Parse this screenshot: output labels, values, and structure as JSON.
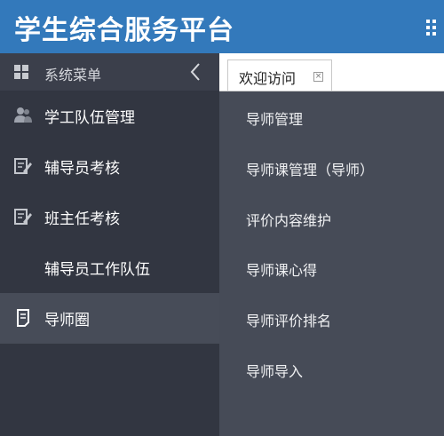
{
  "header": {
    "title": "学生综合服务平台"
  },
  "sidebar": {
    "menu_title": "系统菜单",
    "items": [
      {
        "label": "学工队伍管理",
        "icon": "users-icon"
      },
      {
        "label": "辅导员考核",
        "icon": "edit-icon"
      },
      {
        "label": "班主任考核",
        "icon": "edit-icon"
      },
      {
        "label": "辅导员工作队伍",
        "icon": ""
      },
      {
        "label": "导师圈",
        "icon": "document-icon",
        "active": true
      }
    ]
  },
  "tabs": [
    {
      "label": "欢迎访问",
      "close": "×"
    }
  ],
  "submenu": {
    "items": [
      "导师管理",
      "导师课管理（导师）",
      "评价内容维护",
      "导师课心得",
      "导师评价排名",
      "导师导入"
    ]
  },
  "colors": {
    "header": "#3379bb",
    "sidebar": "#323641",
    "active_item": "#474c58",
    "submenu": "#464b57"
  }
}
